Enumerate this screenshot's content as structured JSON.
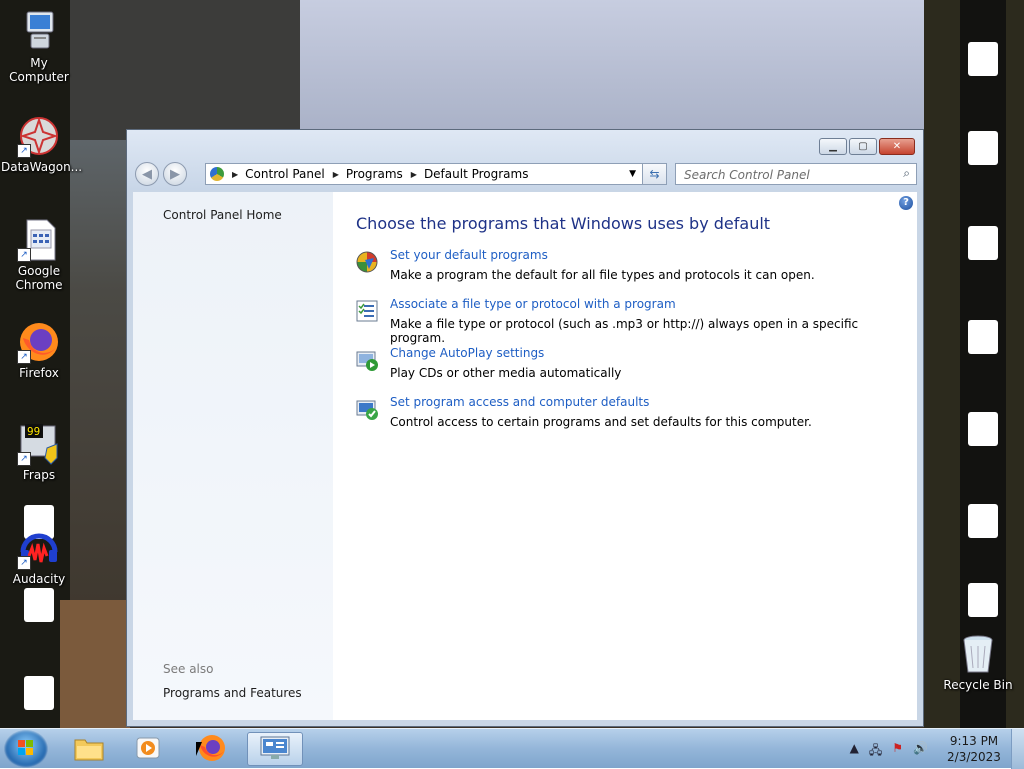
{
  "desktop": {
    "icons": [
      {
        "label": "My Computer",
        "icon": "my-computer-icon"
      },
      {
        "label": "DataWagon...",
        "icon": "datawagon-icon"
      },
      {
        "label": "Google Chrome",
        "icon": "google-chrome-icon"
      },
      {
        "label": "Firefox",
        "icon": "firefox-icon"
      },
      {
        "label": "Fraps",
        "icon": "fraps-icon"
      },
      {
        "label": "Audacity",
        "icon": "audacity-icon"
      },
      {
        "label": "Recycle Bin",
        "icon": "recycle-bin-icon"
      }
    ]
  },
  "window": {
    "breadcrumbs": [
      "Control Panel",
      "Programs",
      "Default Programs"
    ],
    "search_placeholder": "Search Control Panel",
    "controls": {
      "minimize": "minimize-icon",
      "maximize": "maximize-icon",
      "close": "close-icon"
    }
  },
  "sidebar": {
    "home": "Control Panel Home",
    "see_also_heading": "See also",
    "see_also_link": "Programs and Features"
  },
  "content": {
    "title": "Choose the programs that Windows uses by default",
    "tasks": [
      {
        "link": "Set your default programs",
        "desc": "Make a program the default for all file types and protocols it can open.",
        "icon": "default-programs-icon"
      },
      {
        "link": "Associate a file type or protocol with a program",
        "desc": "Make a file type or protocol (such as .mp3 or http://) always open in a specific program.",
        "icon": "file-association-icon"
      },
      {
        "link": "Change AutoPlay settings",
        "desc": "Play CDs or other media automatically",
        "icon": "autoplay-icon"
      },
      {
        "link": "Set program access and computer defaults",
        "desc": "Control access to certain programs and set defaults for this computer.",
        "icon": "program-access-icon"
      }
    ]
  },
  "taskbar": {
    "pinned": [
      "windows-explorer-icon",
      "media-player-icon",
      "firefox-icon",
      "control-panel-icon"
    ],
    "clock_time": "9:13 PM",
    "clock_date": "2/3/2023"
  },
  "colors": {
    "link": "#1e5ec4",
    "title": "#1e3287",
    "taskbar": "#94b6d9"
  }
}
